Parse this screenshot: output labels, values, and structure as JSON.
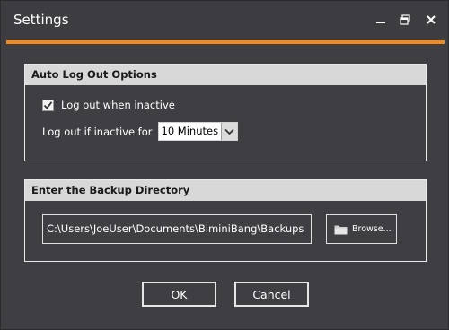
{
  "window": {
    "title": "Settings",
    "accent_color": "#f28a1c",
    "controls": {
      "minimize_icon": "minimize-icon",
      "restore_icon": "restore-icon",
      "close_icon": "close-icon"
    }
  },
  "auto_logout": {
    "header": "Auto Log Out Options",
    "checkbox_label": "Log out when inactive",
    "checkbox_checked": true,
    "inactive_label": "Log out if inactive for",
    "inactive_selected": "10 Minutes"
  },
  "backup": {
    "header": "Enter the Backup Directory",
    "path_value": "C:\\Users\\JoeUser\\Documents\\BiminiBang\\Backups",
    "browse_label": "Browse...",
    "browse_icon": "folder-icon"
  },
  "actions": {
    "ok_label": "OK",
    "cancel_label": "Cancel"
  }
}
